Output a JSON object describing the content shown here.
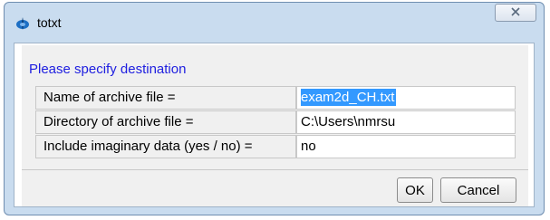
{
  "window": {
    "title": "totxt",
    "close_icon": "close-icon"
  },
  "dialog": {
    "heading": "Please specify destination",
    "fields": [
      {
        "label": "Name of archive file =",
        "value": "exam2d_CH.txt",
        "selected": true
      },
      {
        "label": "Directory of archive file =",
        "value": "C:\\Users\\nmrsu"
      },
      {
        "label": "Include imaginary data (yes / no) =",
        "value": "no"
      }
    ]
  },
  "buttons": {
    "ok_label": "OK",
    "cancel_label": "Cancel"
  },
  "colors": {
    "heading": "#2020e0",
    "selection": "#3399ff",
    "frame": "#c9dcef"
  }
}
